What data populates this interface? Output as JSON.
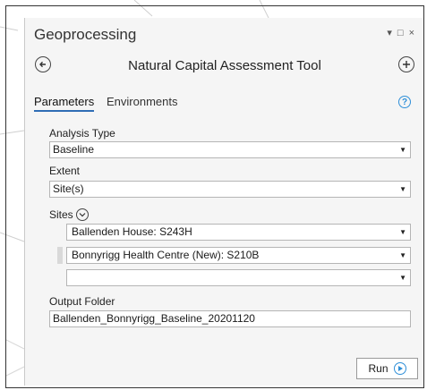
{
  "pane": {
    "title": "Geoprocessing",
    "controls": {
      "menu": "▾",
      "restore": "□",
      "close": "×"
    }
  },
  "tool": {
    "title": "Natural Capital Assessment Tool"
  },
  "tabs": [
    {
      "label": "Parameters",
      "active": true
    },
    {
      "label": "Environments",
      "active": false
    }
  ],
  "params": {
    "analysis_type": {
      "label": "Analysis Type",
      "value": "Baseline"
    },
    "extent": {
      "label": "Extent",
      "value": "Site(s)"
    },
    "sites": {
      "label": "Sites",
      "rows": [
        "Ballenden House: S243H",
        "Bonnyrigg Health Centre (New): S210B",
        ""
      ]
    },
    "output_folder": {
      "label": "Output Folder",
      "value": "Ballenden_Bonnyrigg_Baseline_20201120"
    }
  },
  "run": {
    "label": "Run"
  },
  "icons": {
    "back": "back-arrow-icon",
    "add": "add-icon",
    "help": "help-icon",
    "toggle": "chevron-down-icon",
    "run": "play-icon"
  },
  "colors": {
    "accent": "#2f8fd8",
    "tab_underline": "#2f6db5",
    "panel_bg": "#f5f5f5"
  }
}
